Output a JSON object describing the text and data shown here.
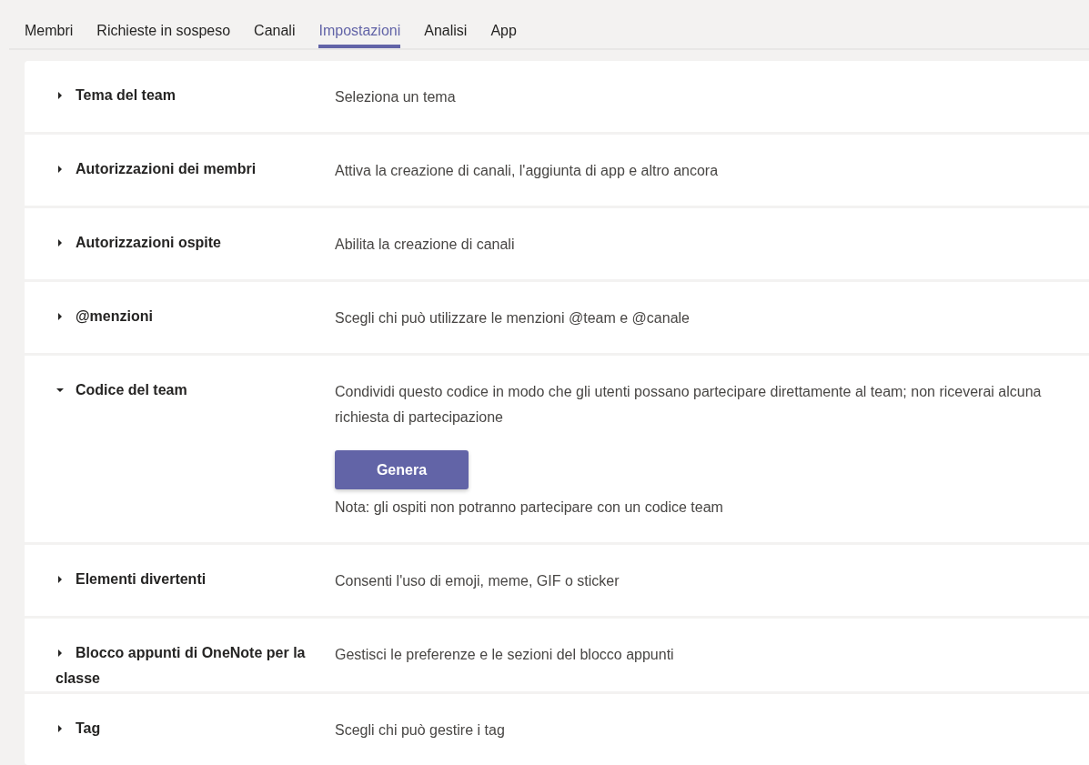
{
  "tabs": [
    {
      "label": "Membri",
      "selected": false
    },
    {
      "label": "Richieste in sospeso",
      "selected": false
    },
    {
      "label": "Canali",
      "selected": false
    },
    {
      "label": "Impostazioni",
      "selected": true
    },
    {
      "label": "Analisi",
      "selected": false
    },
    {
      "label": "App",
      "selected": false
    }
  ],
  "sections": [
    {
      "title": "Tema del team",
      "description": "Seleziona un tema",
      "expanded": false
    },
    {
      "title": "Autorizzazioni dei membri",
      "description": "Attiva la creazione di canali, l'aggiunta di app e altro ancora",
      "expanded": false
    },
    {
      "title": "Autorizzazioni ospite",
      "description": "Abilita la creazione di canali",
      "expanded": false
    },
    {
      "title": "@menzioni",
      "description": "Scegli chi può utilizzare le menzioni @team e @canale",
      "expanded": false
    },
    {
      "title": "Codice del team",
      "description": "Condividi questo codice in modo che gli utenti possano partecipare direttamente al team; non riceverai alcuna richiesta di partecipazione",
      "expanded": true,
      "button": "Genera",
      "note": "Nota: gli ospiti non potranno partecipare con un codice team"
    },
    {
      "title": "Elementi divertenti",
      "description": "Consenti l'uso di emoji, meme, GIF o sticker",
      "expanded": false
    },
    {
      "title": "Blocco appunti di OneNote per la classe",
      "description": "Gestisci le preferenze e le sezioni del blocco appunti",
      "expanded": false
    },
    {
      "title": "Tag",
      "description": "Scegli chi può gestire i tag",
      "expanded": false
    }
  ]
}
